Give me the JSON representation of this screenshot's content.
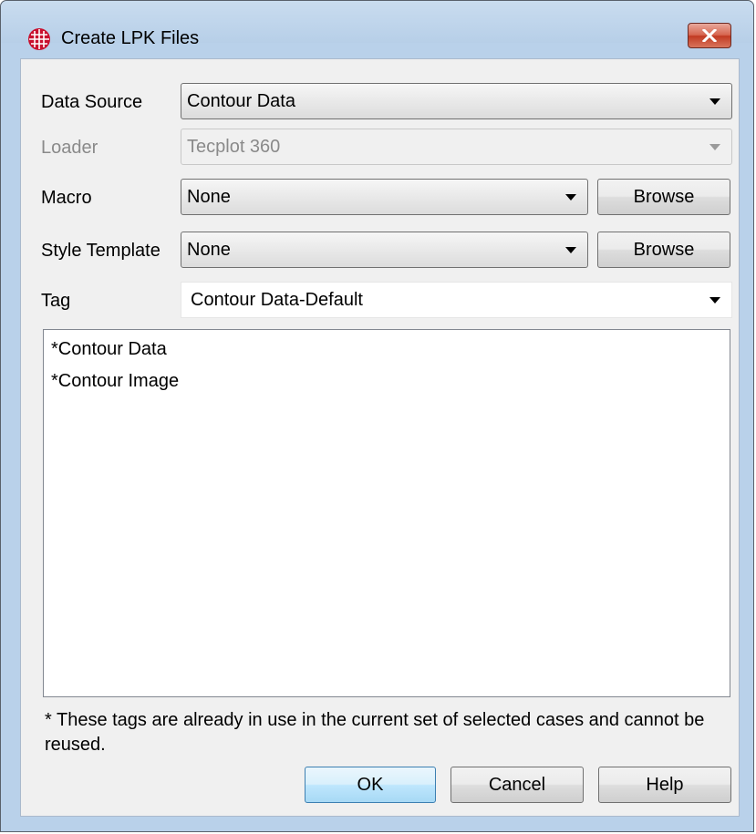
{
  "window": {
    "title": "Create LPK Files",
    "app_icon": "grid-globe-icon",
    "close_icon": "close-icon"
  },
  "form": {
    "data_source": {
      "label": "Data Source",
      "value": "Contour Data"
    },
    "loader": {
      "label": "Loader",
      "value": "Tecplot 360"
    },
    "macro": {
      "label": "Macro",
      "value": "None",
      "browse_label": "Browse"
    },
    "style_template": {
      "label": "Style Template",
      "value": "None",
      "browse_label": "Browse"
    },
    "tag": {
      "label": "Tag",
      "value": "Contour Data-Default"
    }
  },
  "tag_list": {
    "items": [
      "*Contour Data",
      "*Contour Image"
    ]
  },
  "note": "* These tags are already in use in the current set of selected cases and cannot be reused.",
  "buttons": {
    "ok": "OK",
    "cancel": "Cancel",
    "help": "Help"
  },
  "colors": {
    "accent_icon": "#c8102e",
    "close_button": "#c13a22",
    "default_button_border": "#3c7fb1"
  }
}
